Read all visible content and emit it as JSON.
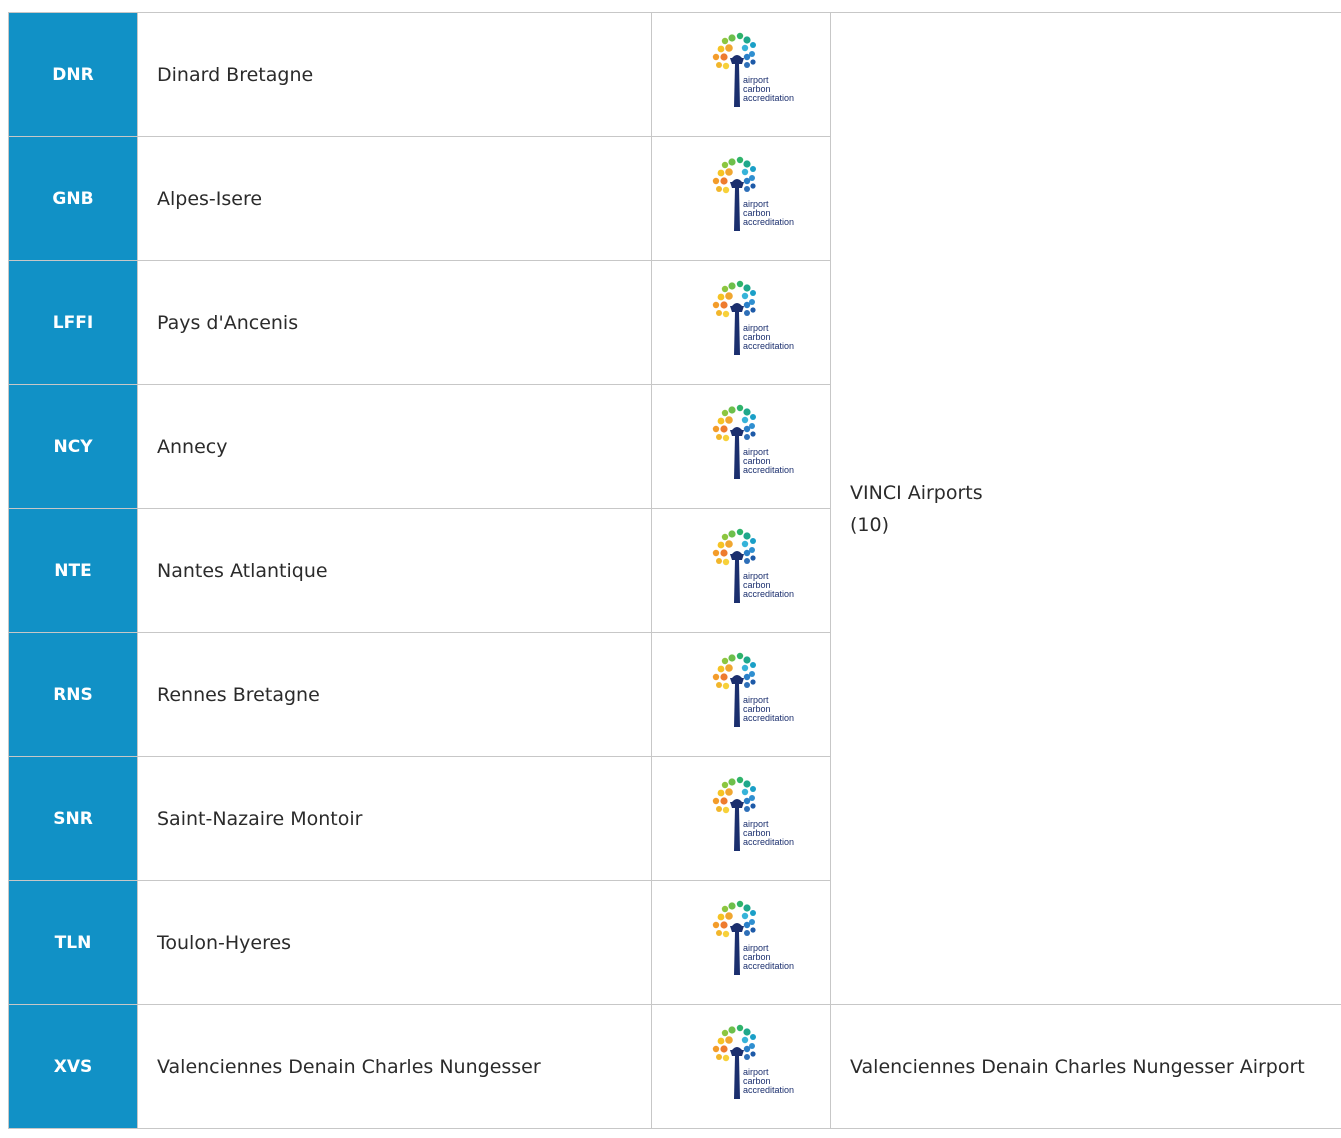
{
  "badge_text": {
    "line1": "airport",
    "line2": "carbon",
    "line3": "accreditation"
  },
  "colors": {
    "code_background": "#1191c6",
    "border": "#c7c7c7",
    "logo_navy": "#1b2f6e"
  },
  "rows": [
    {
      "code": "DNR",
      "name": "Dinard Bretagne",
      "logo_icon": "airport-carbon-accreditation-logo"
    },
    {
      "code": "GNB",
      "name": "Alpes-Isere",
      "logo_icon": "airport-carbon-accreditation-logo"
    },
    {
      "code": "LFFI",
      "name": "Pays d'Ancenis",
      "logo_icon": "airport-carbon-accreditation-logo"
    },
    {
      "code": "NCY",
      "name": "Annecy",
      "logo_icon": "airport-carbon-accreditation-logo"
    },
    {
      "code": "NTE",
      "name": "Nantes Atlantique",
      "logo_icon": "airport-carbon-accreditation-logo"
    },
    {
      "code": "RNS",
      "name": "Rennes Bretagne",
      "logo_icon": "airport-carbon-accreditation-logo"
    },
    {
      "code": "SNR",
      "name": "Saint-Nazaire Montoir",
      "logo_icon": "airport-carbon-accreditation-logo"
    },
    {
      "code": "TLN",
      "name": "Toulon-Hyeres",
      "logo_icon": "airport-carbon-accreditation-logo"
    },
    {
      "code": "XVS",
      "name": "Valenciennes Denain Charles Nungesser",
      "logo_icon": "airport-carbon-accreditation-logo"
    }
  ],
  "groups": {
    "vinci": {
      "name": "VINCI Airports",
      "count": "(10)"
    },
    "xvs": {
      "name": "Valenciennes Denain Charles Nungesser Airport"
    }
  }
}
